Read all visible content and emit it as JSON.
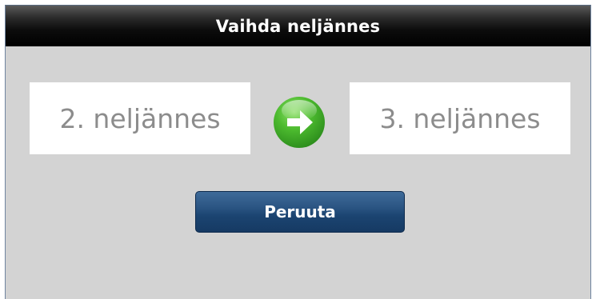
{
  "dialog": {
    "title": "Vaihda neljännes",
    "from_quarter": "2. neljännes",
    "to_quarter": "3. neljännes",
    "arrow_icon": "arrow-right-icon",
    "cancel_label": "Peruuta"
  },
  "colors": {
    "arrow_green": "#3aa827",
    "button_blue": "#1b4471",
    "panel_gray": "#d3d3d3"
  }
}
